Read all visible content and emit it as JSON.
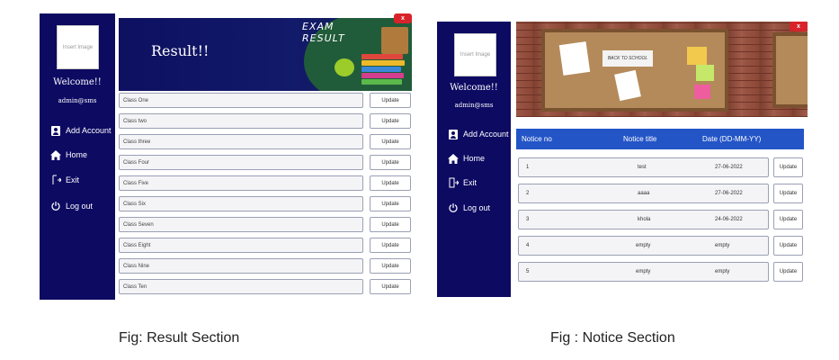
{
  "result_panel": {
    "sidebar": {
      "image_placeholder": "Insert Image",
      "welcome": "Welcome!!",
      "username": "admin@sms",
      "nav": [
        {
          "label": "Add Account",
          "icon": "user-icon"
        },
        {
          "label": "Home",
          "icon": "home-icon"
        },
        {
          "label": "Exit",
          "icon": "exit-icon"
        },
        {
          "label": "Log out",
          "icon": "power-icon"
        }
      ]
    },
    "close_label": "x",
    "banner": {
      "title": "Result!!",
      "exam_line1": "EXAM",
      "exam_line2": "RESULT"
    },
    "rows": [
      {
        "label": "Class One",
        "button": "Update"
      },
      {
        "label": "Class two",
        "button": "Update"
      },
      {
        "label": "Class three",
        "button": "Update"
      },
      {
        "label": "Class Four",
        "button": "Update"
      },
      {
        "label": "Class Five",
        "button": "Update"
      },
      {
        "label": "Class Six",
        "button": "Update"
      },
      {
        "label": "Class Seven",
        "button": "Update"
      },
      {
        "label": "Class Eight",
        "button": "Update"
      },
      {
        "label": "Class Nine",
        "button": "Update"
      },
      {
        "label": "Class Ten",
        "button": "Update"
      }
    ]
  },
  "notice_panel": {
    "sidebar": {
      "image_placeholder": "Insert Image",
      "welcome": "Welcome!!",
      "username": "admin@sms",
      "nav": [
        {
          "label": "Add Account",
          "icon": "user-icon"
        },
        {
          "label": "Home",
          "icon": "home-icon"
        },
        {
          "label": "Exit",
          "icon": "exit-icon"
        },
        {
          "label": "Log out",
          "icon": "power-icon"
        }
      ]
    },
    "close_label": "x",
    "board_note": "BACK TO SCHOOL",
    "table": {
      "headers": [
        "Notice no",
        "Notice title",
        "Date (DD-MM-YY)"
      ],
      "rows": [
        {
          "no": "1",
          "title": "test",
          "date": "27-06-2022",
          "button": "Update"
        },
        {
          "no": "2",
          "title": "aaaa",
          "date": "27-06-2022",
          "button": "Update"
        },
        {
          "no": "3",
          "title": "khola",
          "date": "24-06-2022",
          "button": "Update"
        },
        {
          "no": "4",
          "title": "empty",
          "date": "empty",
          "button": "Update"
        },
        {
          "no": "5",
          "title": "empty",
          "date": "empty",
          "button": "Update"
        }
      ]
    }
  },
  "captions": {
    "left": "Fig: Result Section",
    "right": "Fig : Notice Section"
  },
  "colors": {
    "sidebar": "#0d0a62",
    "table_header": "#2455c7",
    "close": "#d8232a"
  }
}
